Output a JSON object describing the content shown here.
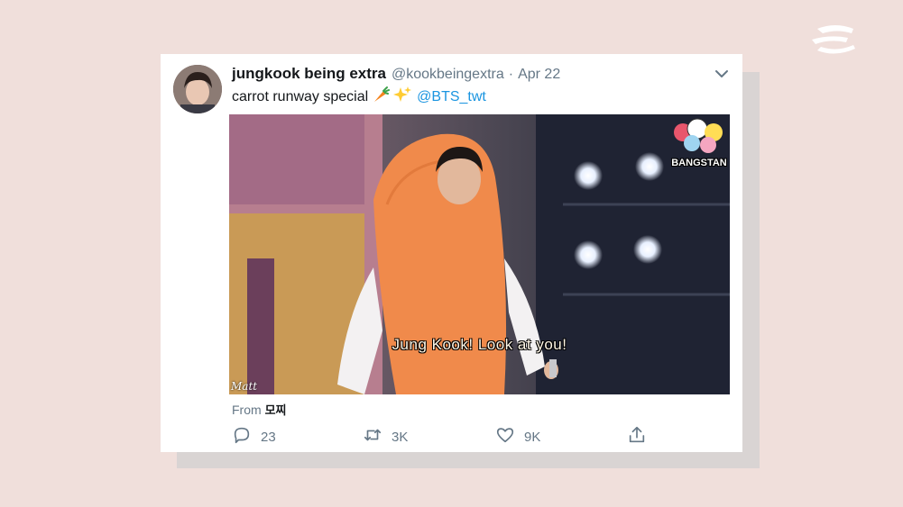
{
  "brand": {
    "logo_icon": "brand-e-logo-icon"
  },
  "tweet": {
    "author_name": "jungkook being extra",
    "author_handle": "@kookbeingextra",
    "separator": "·",
    "date": "Apr 22",
    "text": "carrot runway special",
    "emojis": [
      "carrot-emoji",
      "sparkles-emoji"
    ],
    "mention": "@BTS_twt",
    "source_label": "From",
    "source_name": "모찌"
  },
  "media": {
    "subtitle": "Jung Kook! Look at you!",
    "watermark_left": "Matt",
    "watermark_right": "BANGSTAN"
  },
  "actions": {
    "reply_count": "23",
    "retweet_count": "3K",
    "like_count": "9K"
  },
  "colors": {
    "background": "#f0dfdb",
    "card": "#ffffff",
    "link": "#1b95e0",
    "muted": "#657786",
    "carrot": "#f08a4b"
  }
}
